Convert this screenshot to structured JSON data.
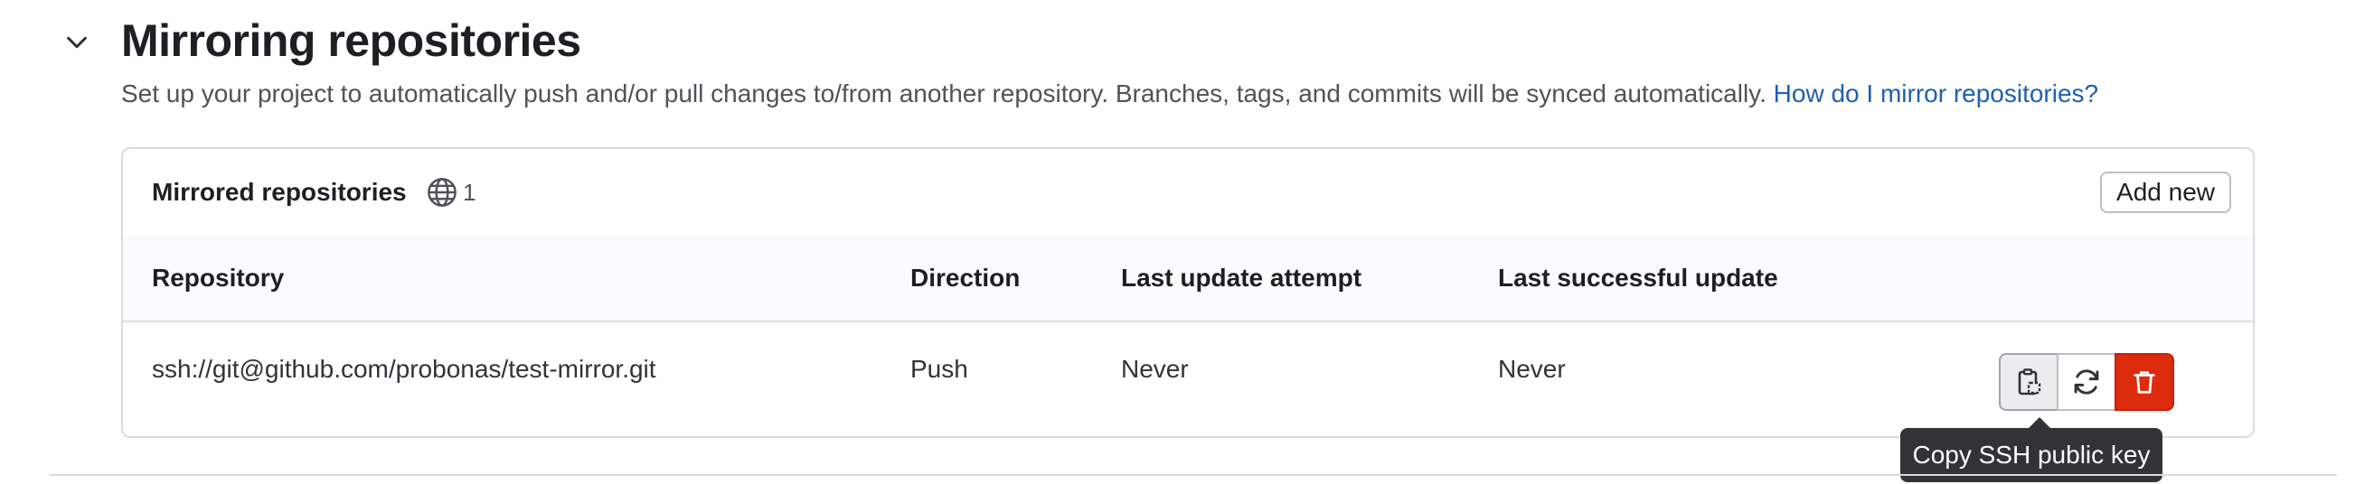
{
  "section": {
    "title": "Mirroring repositories",
    "description": "Set up your project to automatically push and/or pull changes to/from another repository. Branches, tags, and commits will be synced automatically.",
    "help_link": "How do I mirror repositories?",
    "collapse_icon": "chevron-down-icon"
  },
  "card": {
    "title": "Mirrored repositories",
    "count_icon": "globe-icon",
    "count": "1",
    "add_button": "Add new"
  },
  "table": {
    "headers": [
      "Repository",
      "Direction",
      "Last update attempt",
      "Last successful update"
    ],
    "rows": [
      {
        "repository": "ssh://git@github.com/probonas/test-mirror.git",
        "direction": "Push",
        "last_attempt": "Never",
        "last_success": "Never"
      }
    ],
    "row_action_icons": [
      "copy-ssh-key-icon",
      "sync-icon",
      "trash-icon"
    ]
  },
  "tooltip": {
    "text": "Copy SSH public key"
  },
  "colors": {
    "link": "#1f5fb1",
    "danger": "#dd2b0e",
    "border": "#dcdcde",
    "header_bg": "#fbfafd",
    "tooltip_bg": "#333238"
  }
}
